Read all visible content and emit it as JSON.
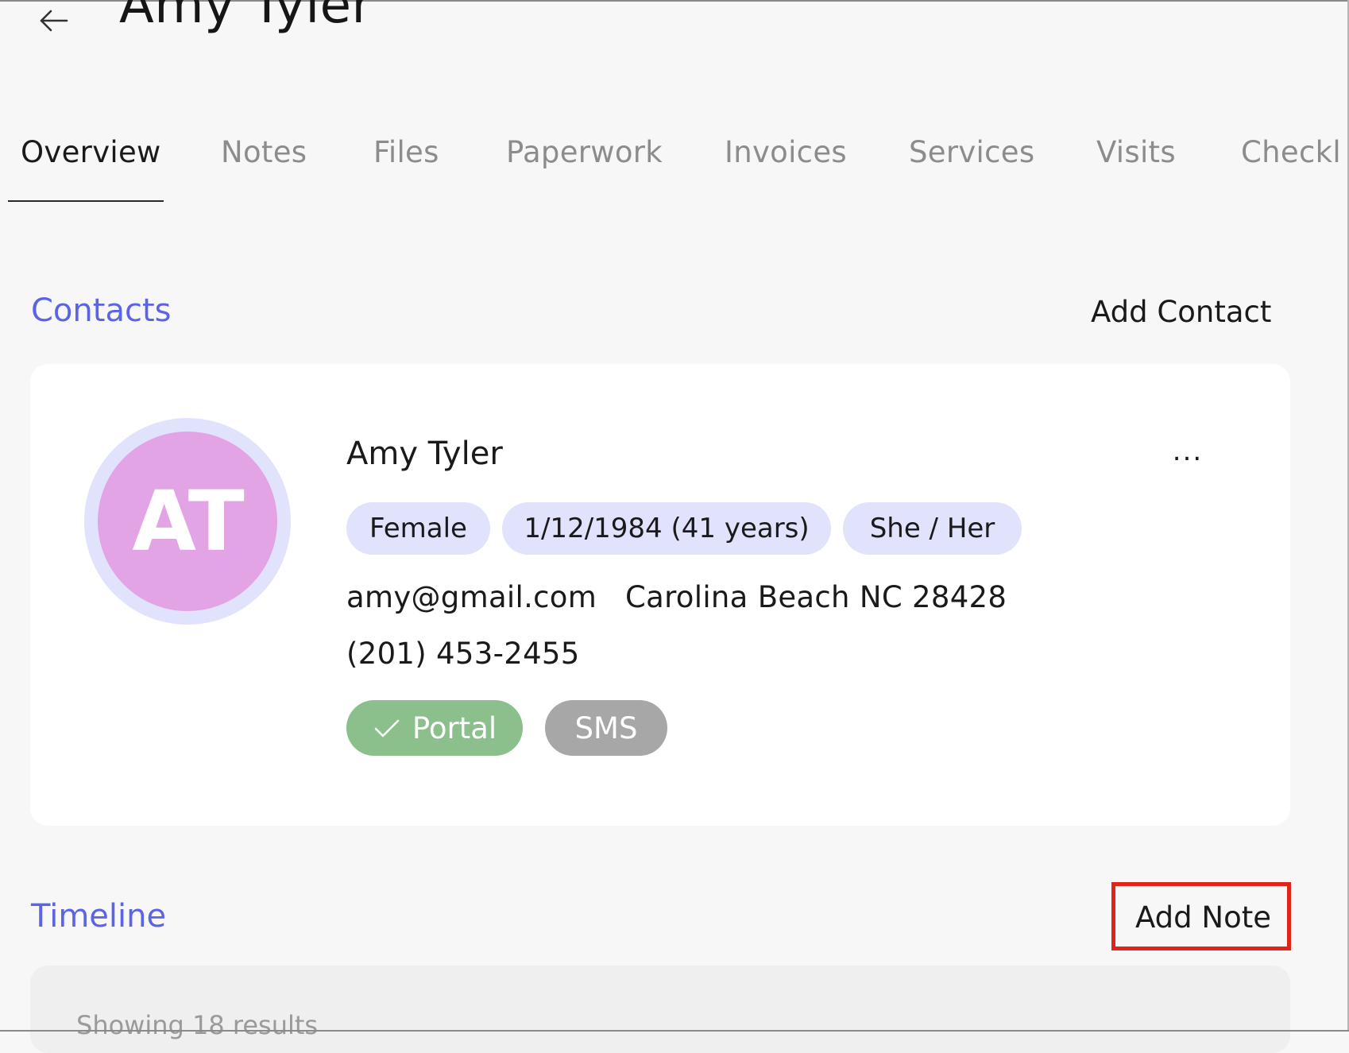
{
  "header": {
    "title": "Amy Tyler"
  },
  "tabs": [
    {
      "label": "Overview"
    },
    {
      "label": "Notes"
    },
    {
      "label": "Files"
    },
    {
      "label": "Paperwork"
    },
    {
      "label": "Invoices"
    },
    {
      "label": "Services"
    },
    {
      "label": "Visits"
    },
    {
      "label": "Checkli"
    }
  ],
  "contacts": {
    "title": "Contacts",
    "action_label": "Add Contact",
    "card": {
      "initials": "AT",
      "name": "Amy Tyler",
      "more_label": "...",
      "chips": [
        "Female",
        "1/12/1984 (41 years)",
        "She / Her"
      ],
      "email": "amy@gmail.com",
      "location": "Carolina Beach NC 28428",
      "phone": "(201) 453-2455",
      "portal_label": "Portal",
      "sms_label": "SMS"
    }
  },
  "timeline": {
    "title": "Timeline",
    "action_label": "Add Note",
    "results_text": "Showing 18 results"
  },
  "colors": {
    "accent": "#5b63e6",
    "chip_bg": "#e1e2fb",
    "avatar_bg": "#e3a4e5",
    "portal_bg": "#8bbf8c",
    "sms_bg": "#a7a7a7",
    "highlight": "#e02418"
  },
  "icons": {
    "back": "arrow-left-icon",
    "portal": "check-icon"
  }
}
